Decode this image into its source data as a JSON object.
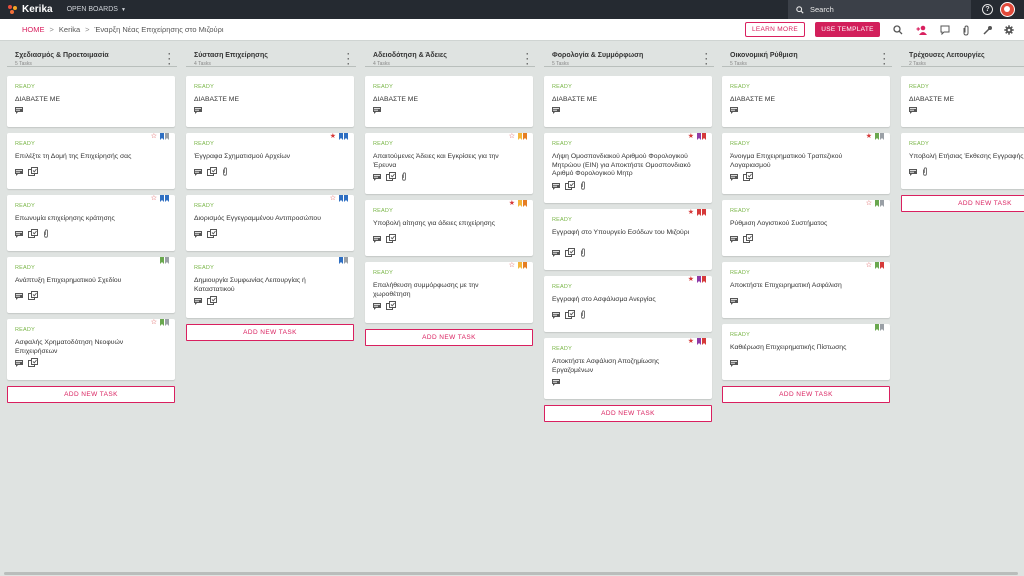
{
  "app": {
    "name": "Kerika",
    "open_boards": "OPEN BOARDS"
  },
  "search": {
    "label": "Search"
  },
  "help_icon": "?",
  "breadcrumb": {
    "home": "HOME",
    "org": "Kerika",
    "board": "Έναρξη Νέας Επιχείρησης στο Μιζούρι",
    "sep": ">"
  },
  "buttons": {
    "learn_more": "LEARN MORE",
    "use_template": "USE TEMPLATE"
  },
  "add_task_label": "ADD NEW TASK",
  "colors": {
    "accent": "#d9205f",
    "ready": "#7ab648",
    "topbar": "#252a31"
  },
  "columns": [
    {
      "title": "Σχεδιασμός & Προετοιμασία",
      "count": "5 Tasks",
      "cards": [
        {
          "status": "READY",
          "title": "ΔΙΑΒΑΣΤΕ ΜΕ",
          "flags": [],
          "icons": [
            "chat"
          ]
        },
        {
          "status": "READY",
          "title": "Επιλέξτε τη Δομή της Επιχείρησής σας",
          "flags": [
            "star-empty",
            "blue",
            "gray"
          ],
          "icons": [
            "chat",
            "checklist"
          ]
        },
        {
          "status": "READY",
          "title": "Επωνυμία επιχείρησης κράτησης",
          "flags": [
            "star-empty",
            "blue",
            "blue"
          ],
          "icons": [
            "chat",
            "checklist",
            "clip"
          ]
        },
        {
          "status": "READY",
          "title": "Ανάπτυξη Επιχειρηματικού Σχεδίου",
          "flags": [
            "green",
            "gray"
          ],
          "icons": [
            "chat",
            "checklist"
          ]
        },
        {
          "status": "READY",
          "title": "Ασφαλής Χρηματοδότηση Νεοφυών Επιχειρήσεων",
          "flags": [
            "star-empty",
            "green",
            "gray"
          ],
          "icons": [
            "chat",
            "checklist"
          ]
        }
      ]
    },
    {
      "title": "Σύσταση Επιχείρησης",
      "count": "4 Tasks",
      "cards": [
        {
          "status": "READY",
          "title": "ΔΙΑΒΑΣΤΕ ΜΕ",
          "flags": [],
          "icons": [
            "chat"
          ]
        },
        {
          "status": "READY",
          "title": "Έγγραφα Σχηματισμού Αρχείων",
          "flags": [
            "star-full",
            "blue",
            "blue"
          ],
          "icons": [
            "chat",
            "checklist",
            "clip"
          ]
        },
        {
          "status": "READY",
          "title": "Διορισμός Εγγεγραμμένου Αντιπροσώπου",
          "flags": [
            "star-empty",
            "blue",
            "blue"
          ],
          "icons": [
            "chat",
            "checklist"
          ]
        },
        {
          "status": "READY",
          "title": "Δημιουργία Συμφωνίας Λειτουργίας ή Καταστατικού",
          "flags": [
            "blue",
            "gray"
          ],
          "icons": [
            "chat",
            "checklist"
          ]
        }
      ]
    },
    {
      "title": "Αδειοδότηση & Άδειες",
      "count": "4 Tasks",
      "cards": [
        {
          "status": "READY",
          "title": "ΔΙΑΒΑΣΤΕ ΜΕ",
          "flags": [],
          "icons": [
            "chat"
          ]
        },
        {
          "status": "READY",
          "title": "Απαιτούμενες Άδειες και Εγκρίσεις για την Έρευνα",
          "flags": [
            "star-empty",
            "yellow",
            "orange"
          ],
          "icons": [
            "chat",
            "checklist",
            "clip"
          ]
        },
        {
          "status": "READY",
          "title": "Υποβολή αίτησης για άδειες επιχείρησης",
          "flags": [
            "star-full",
            "yellow",
            "orange"
          ],
          "icons": [
            "chat",
            "checklist"
          ]
        },
        {
          "status": "READY",
          "title": "Επαλήθευση συμμόρφωσης με την χωροθέτηση",
          "flags": [
            "star-empty",
            "yellow",
            "orange"
          ],
          "icons": [
            "chat",
            "checklist"
          ]
        }
      ]
    },
    {
      "title": "Φορολογία & Συμμόρφωση",
      "count": "5 Tasks",
      "cards": [
        {
          "status": "READY",
          "title": "ΔΙΑΒΑΣΤΕ ΜΕ",
          "flags": [],
          "icons": [
            "chat"
          ]
        },
        {
          "status": "READY",
          "title": "Λήψη Ομοσπονδιακού Αριθμού Φορολογικού Μητρώου (EIN) για Αποκτήστε Ομοσπονδιακό Αριθμό Φορολογικού Μητρ",
          "flags": [
            "star-full",
            "purple",
            "red"
          ],
          "icons": [
            "chat",
            "checklist",
            "clip"
          ]
        },
        {
          "status": "READY",
          "title": "Εγγραφή στο Υπουργείο Εσόδων του Μιζούρι",
          "flags": [
            "star-full",
            "red",
            "red"
          ],
          "icons": [
            "chat",
            "checklist",
            "clip"
          ]
        },
        {
          "status": "READY",
          "title": "Εγγραφή στο Ασφάλισμα Ανεργίας",
          "flags": [
            "star-full",
            "purple",
            "red"
          ],
          "icons": [
            "chat",
            "checklist",
            "clip"
          ]
        },
        {
          "status": "READY",
          "title": "Αποκτήστε Ασφάλιση Αποζημίωσης Εργαζομένων",
          "flags": [
            "star-full",
            "purple",
            "red"
          ],
          "icons": [
            "chat"
          ]
        }
      ]
    },
    {
      "title": "Οικονομική Ρύθμιση",
      "count": "5 Tasks",
      "cards": [
        {
          "status": "READY",
          "title": "ΔΙΑΒΑΣΤΕ ΜΕ",
          "flags": [],
          "icons": [
            "chat"
          ]
        },
        {
          "status": "READY",
          "title": "Άνοιγμα Επιχειρηματικού Τραπεζικού Λογαριασμού",
          "flags": [
            "star-full",
            "green",
            "gray"
          ],
          "icons": [
            "chat",
            "checklist"
          ]
        },
        {
          "status": "READY",
          "title": "Ρύθμιση Λογιστικού Συστήματος",
          "flags": [
            "star-empty",
            "green",
            "gray"
          ],
          "icons": [
            "chat",
            "checklist"
          ]
        },
        {
          "status": "READY",
          "title": "Αποκτήστε Επιχειρηματική Ασφάλιση",
          "flags": [
            "star-empty",
            "green",
            "red"
          ],
          "icons": [
            "chat"
          ]
        },
        {
          "status": "READY",
          "title": "Καθιέρωση Επιχειρηματικής Πίστωσης",
          "flags": [
            "green",
            "gray"
          ],
          "icons": [
            "chat"
          ]
        }
      ]
    },
    {
      "title": "Τρέχουσες Λειτουργίες",
      "count": "2 Tasks",
      "cards": [
        {
          "status": "READY",
          "title": "ΔΙΑΒΑΣΤΕ ΜΕ",
          "flags": [],
          "icons": [
            "chat"
          ]
        },
        {
          "status": "READY",
          "title": "Υποβολή Ετήσιας Έκθεσης Εγγραφής",
          "flags": [],
          "icons": [
            "chat",
            "clip"
          ]
        }
      ]
    }
  ]
}
